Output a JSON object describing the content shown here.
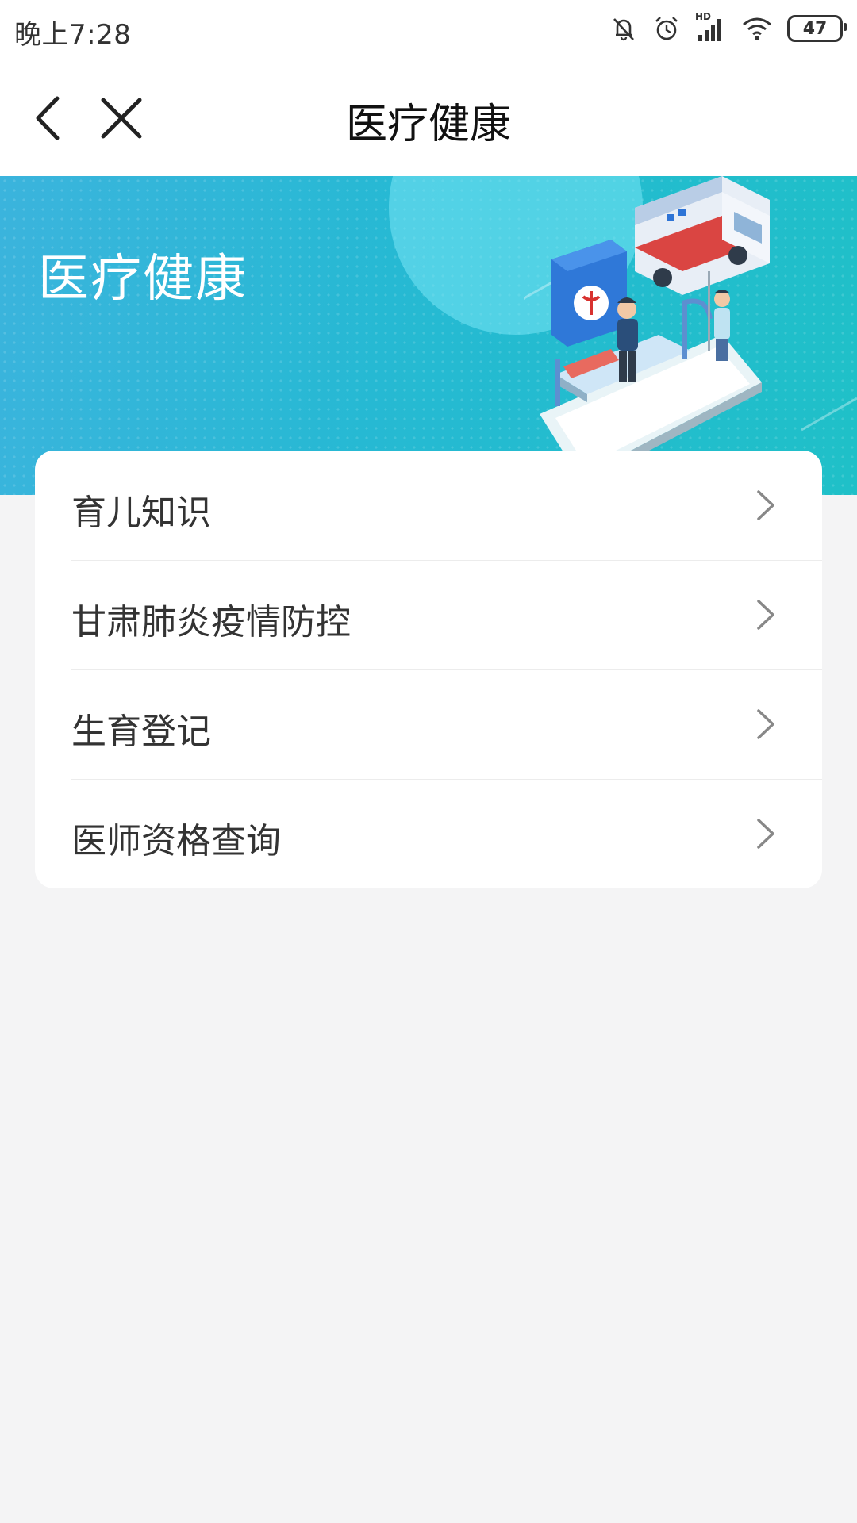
{
  "status_bar": {
    "time": "晚上7:28",
    "battery": "47",
    "signal_label": "HD",
    "icons": [
      "mute-icon",
      "alarm-icon",
      "signal-icon",
      "wifi-icon",
      "battery-icon"
    ]
  },
  "nav": {
    "title": "医疗健康",
    "back_icon": "chevron-left-icon",
    "close_icon": "close-icon"
  },
  "banner": {
    "title": "医疗健康",
    "colors": {
      "start": "#3bb4dd",
      "end": "#1fc0c8"
    },
    "illustration": "medical-illustration"
  },
  "menu": {
    "items": [
      {
        "label": "育儿知识"
      },
      {
        "label": "甘肃肺炎疫情防控"
      },
      {
        "label": "生育登记"
      },
      {
        "label": "医师资格查询"
      }
    ]
  }
}
